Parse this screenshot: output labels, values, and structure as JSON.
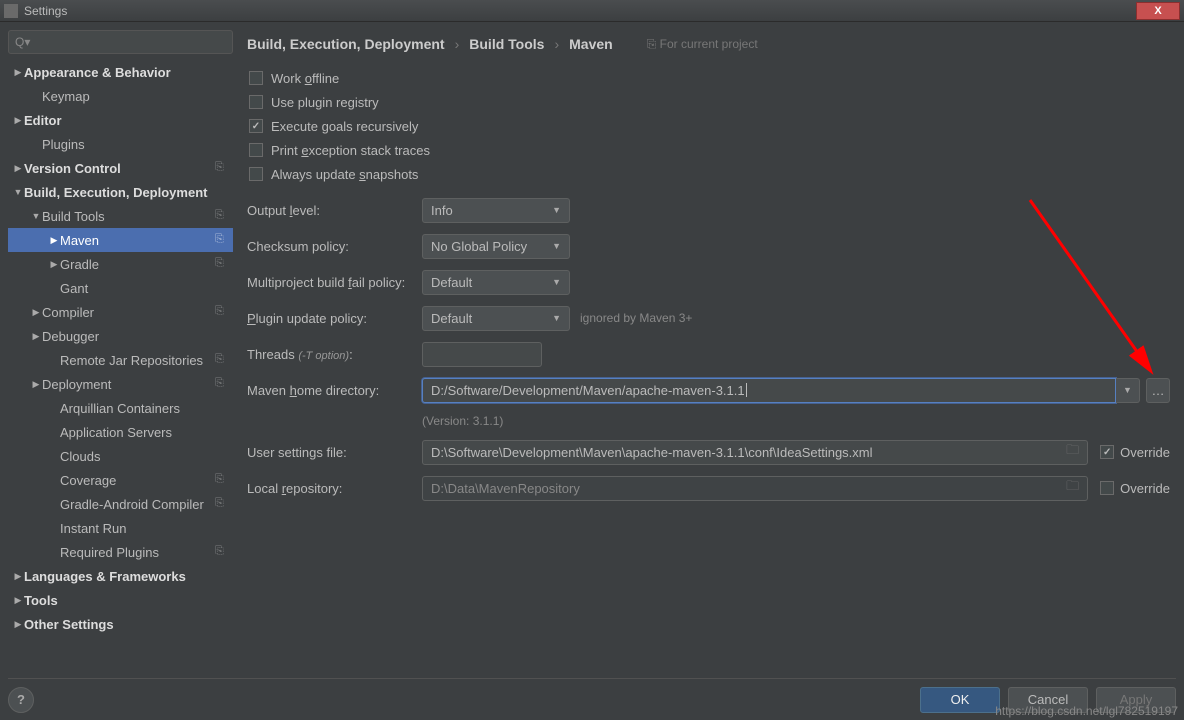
{
  "window": {
    "title": "Settings",
    "close": "X"
  },
  "search": {
    "placeholder": ""
  },
  "tree": {
    "appearance": "Appearance & Behavior",
    "keymap": "Keymap",
    "editor": "Editor",
    "plugins": "Plugins",
    "version_control": "Version Control",
    "bed": "Build, Execution, Deployment",
    "build_tools": "Build Tools",
    "maven": "Maven",
    "gradle": "Gradle",
    "gant": "Gant",
    "compiler": "Compiler",
    "debugger": "Debugger",
    "remote_jar": "Remote Jar Repositories",
    "deployment": "Deployment",
    "arquillian": "Arquillian Containers",
    "app_servers": "Application Servers",
    "clouds": "Clouds",
    "coverage": "Coverage",
    "gradle_android": "Gradle-Android Compiler",
    "instant_run": "Instant Run",
    "required_plugins": "Required Plugins",
    "languages": "Languages & Frameworks",
    "tools": "Tools",
    "other": "Other Settings"
  },
  "breadcrumb": {
    "a": "Build, Execution, Deployment",
    "b": "Build Tools",
    "c": "Maven",
    "hint": "For current project"
  },
  "form": {
    "work_offline": "Work offline",
    "use_plugin_registry": "Use plugin registry",
    "execute_goals": "Execute goals recursively",
    "print_exception": "Print exception stack traces",
    "always_update": "Always update snapshots",
    "output_level_lbl": "Output level:",
    "output_level_val": "Info",
    "checksum_lbl": "Checksum policy:",
    "checksum_val": "No Global Policy",
    "multiproject_lbl": "Multiproject build fail policy:",
    "multiproject_val": "Default",
    "plugin_update_lbl": "Plugin update policy:",
    "plugin_update_val": "Default",
    "plugin_update_hint": "ignored by Maven 3+",
    "threads_lbl": "Threads (-T option):",
    "threads_val": "",
    "maven_home_lbl": "Maven home directory:",
    "maven_home_val": "D:/Software/Development/Maven/apache-maven-3.1.1",
    "version": "(Version: 3.1.1)",
    "user_settings_lbl": "User settings file:",
    "user_settings_val": "D:\\Software\\Development\\Maven\\apache-maven-3.1.1\\conf\\IdeaSettings.xml",
    "local_repo_lbl": "Local repository:",
    "local_repo_val": "D:\\Data\\MavenRepository",
    "override": "Override"
  },
  "footer": {
    "help": "?",
    "ok": "OK",
    "cancel": "Cancel",
    "apply": "Apply"
  },
  "watermark": "https://blog.csdn.net/lgl782519197"
}
